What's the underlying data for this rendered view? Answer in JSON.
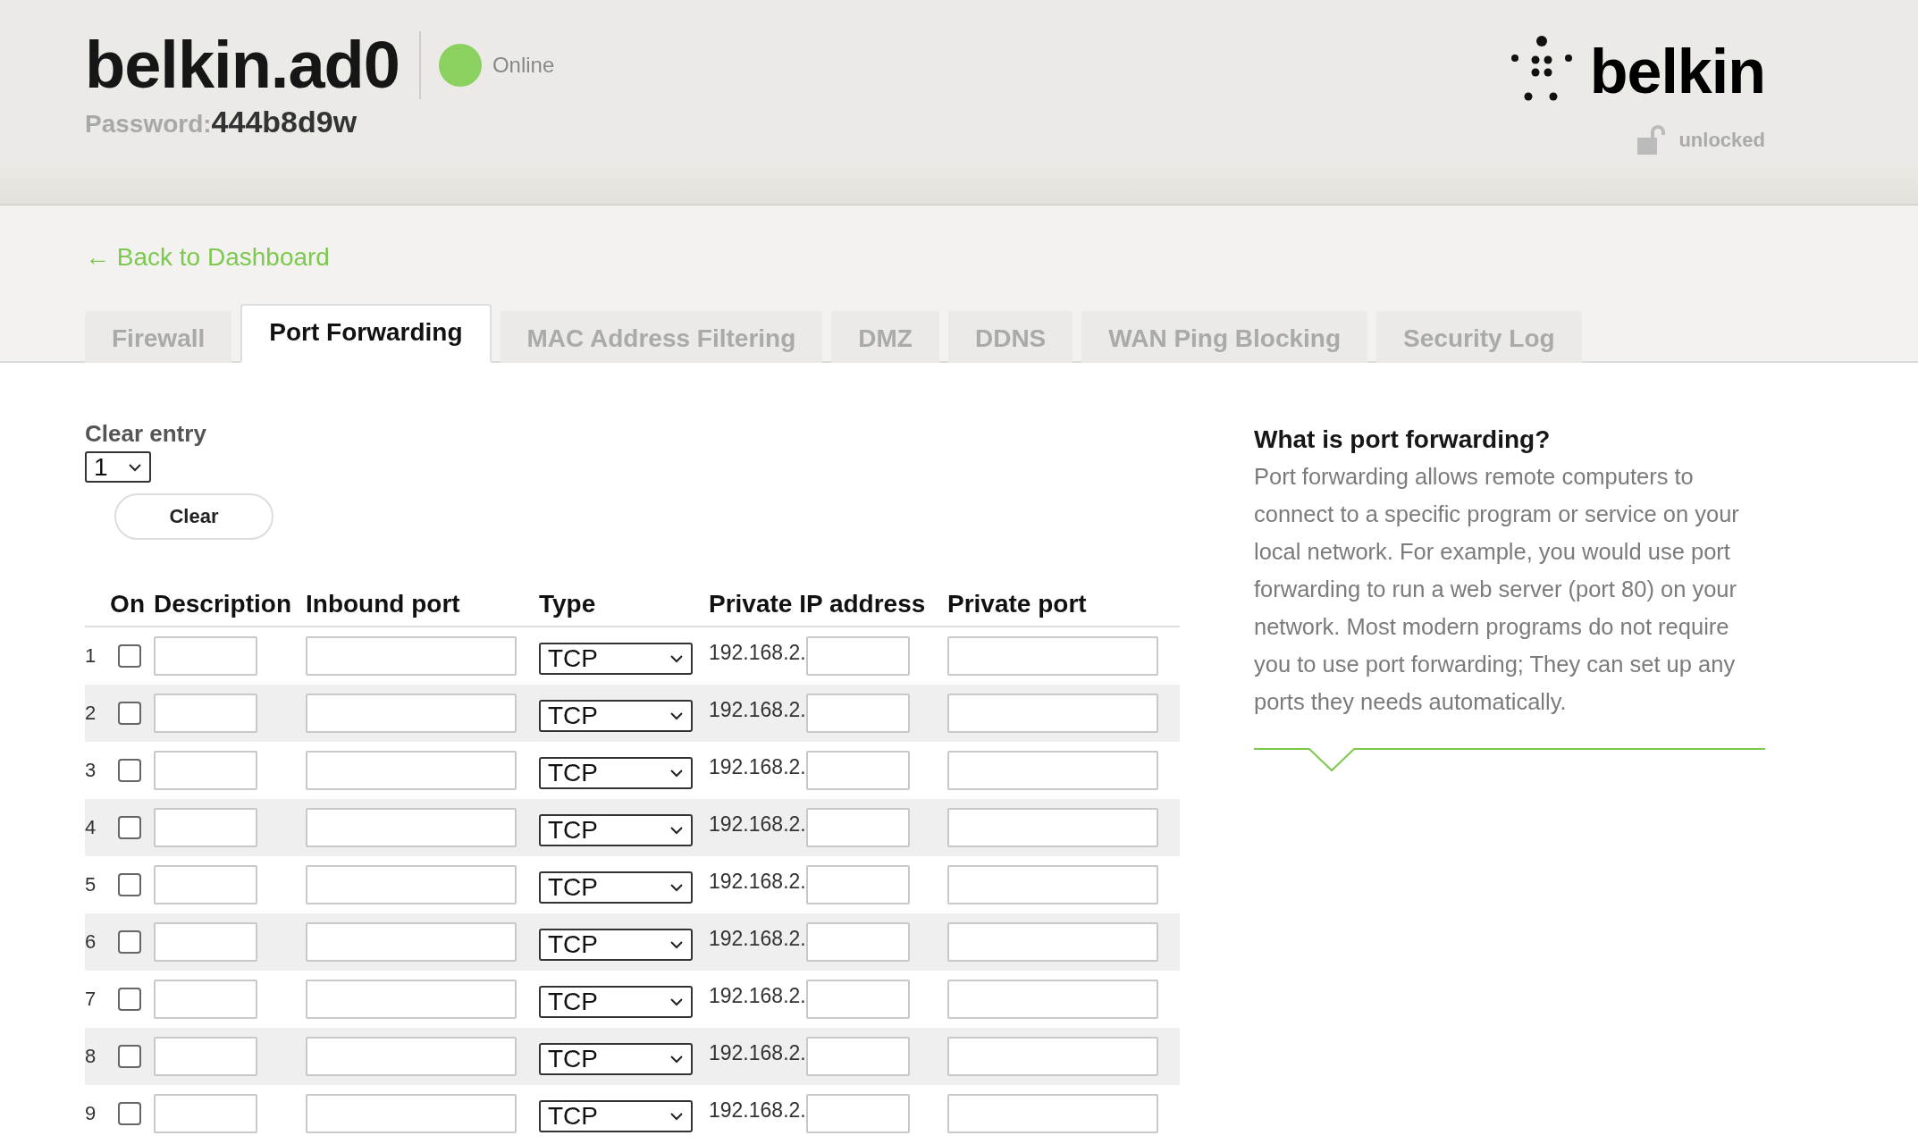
{
  "header": {
    "title": "belkin.ad0",
    "status": {
      "label": "Online",
      "online": true
    },
    "password_label": "Password:",
    "password": "444b8d9w",
    "logo": "belkin",
    "lock": {
      "label": "unlocked",
      "locked": false
    }
  },
  "back_link": "← Back to Dashboard",
  "tabs": [
    {
      "label": "Firewall",
      "selected": false
    },
    {
      "label": "Port Forwarding",
      "selected": true
    },
    {
      "label": "MAC Address Filtering",
      "selected": false
    },
    {
      "label": "DMZ",
      "selected": false
    },
    {
      "label": "DDNS",
      "selected": false
    },
    {
      "label": "WAN Ping Blocking",
      "selected": false
    },
    {
      "label": "Security Log",
      "selected": false
    }
  ],
  "clear_entry": {
    "label": "Clear entry",
    "value": "1",
    "button": "Clear"
  },
  "table": {
    "columns": [
      "On",
      "Description",
      "Inbound port",
      "Type",
      "Private IP address",
      "Private port"
    ],
    "rows": [
      {
        "number": "1",
        "on": false,
        "type": "TCP",
        "ip_prefix": "192.168.2."
      },
      {
        "number": "2",
        "on": false,
        "type": "TCP",
        "ip_prefix": "192.168.2."
      },
      {
        "number": "3",
        "on": false,
        "type": "TCP",
        "ip_prefix": "192.168.2."
      },
      {
        "number": "4",
        "on": false,
        "type": "TCP",
        "ip_prefix": "192.168.2."
      },
      {
        "number": "5",
        "on": false,
        "type": "TCP",
        "ip_prefix": "192.168.2."
      },
      {
        "number": "6",
        "on": false,
        "type": "TCP",
        "ip_prefix": "192.168.2."
      },
      {
        "number": "7",
        "on": false,
        "type": "TCP",
        "ip_prefix": "192.168.2."
      },
      {
        "number": "8",
        "on": false,
        "type": "TCP",
        "ip_prefix": "192.168.2."
      },
      {
        "number": "9",
        "on": false,
        "type": "TCP",
        "ip_prefix": "192.168.2."
      }
    ]
  },
  "help": {
    "heading": "What is port forwarding?",
    "text": "Port forwarding allows remote computers to connect to a specific program or service on your local network. For example, you would use port forwarding to run a web server (port 80) on your network. Most modern programs do not require you to use port forwarding; They can set up any ports they needs automatically."
  }
}
